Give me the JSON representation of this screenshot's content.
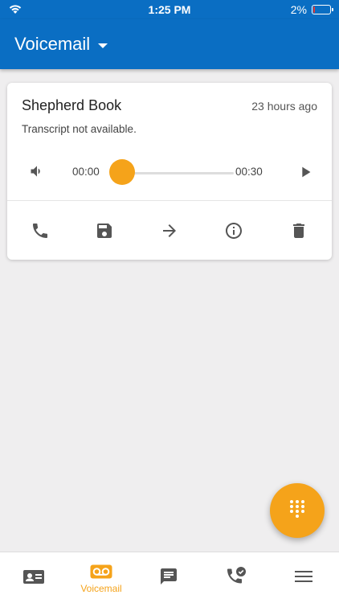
{
  "status_bar": {
    "time": "1:25 PM",
    "battery": "2%"
  },
  "app_bar": {
    "title": "Voicemail"
  },
  "voicemail": {
    "caller": "Shepherd Book",
    "time_ago": "23 hours ago",
    "transcript": "Transcript not available.",
    "elapsed": "00:00",
    "duration": "00:30",
    "progress": 0
  },
  "actions": [
    "phone-icon",
    "save-icon",
    "forward-icon",
    "info-icon",
    "delete-icon"
  ],
  "bottom_nav": {
    "items": [
      {
        "icon": "contacts-icon",
        "label": ""
      },
      {
        "icon": "voicemail-icon",
        "label": "Voicemail",
        "active": true
      },
      {
        "icon": "chat-icon",
        "label": ""
      },
      {
        "icon": "call-history-icon",
        "label": ""
      },
      {
        "icon": "menu-icon",
        "label": ""
      }
    ]
  },
  "colors": {
    "primary": "#0a6ec3",
    "accent": "#f5a31a",
    "icon_gray": "#555555"
  }
}
